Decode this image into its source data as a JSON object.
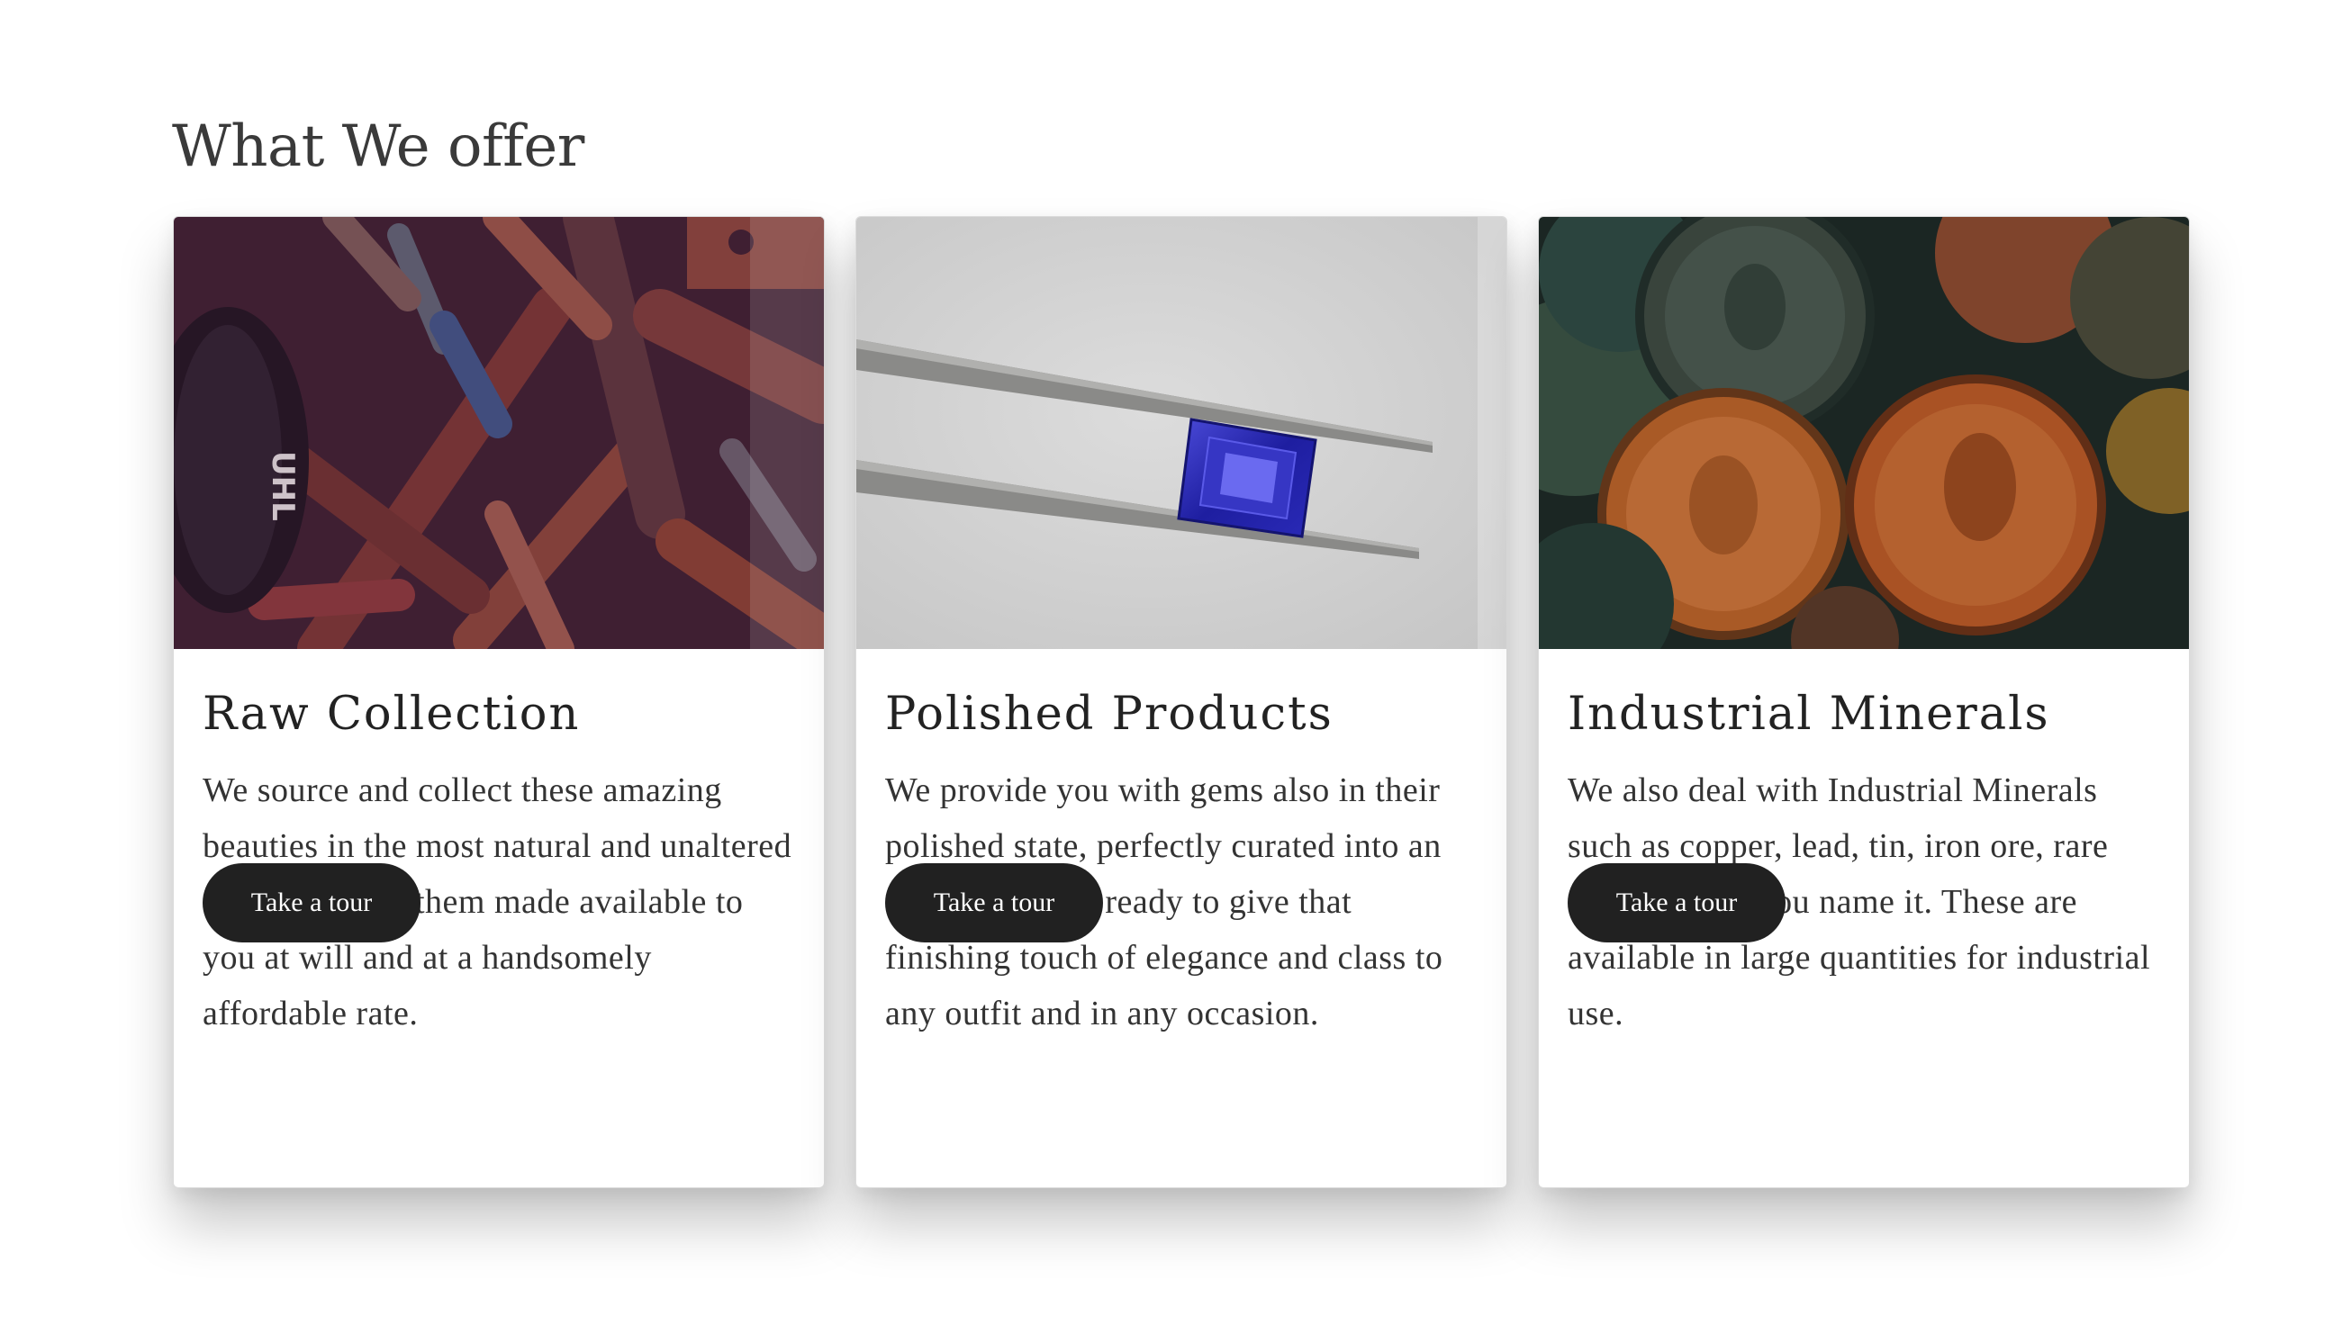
{
  "section": {
    "title": "What We offer"
  },
  "cards": [
    {
      "title": "Raw Collection",
      "text": "We source and collect these amazing beauties in the most natural and unaltered form and have them made available to you at will and at a handsomely affordable rate.",
      "button_label": "Take a tour",
      "image_label": "UHL"
    },
    {
      "title": "Polished Products",
      "text": "We provide you with gems also in their polished state, perfectly curated into an artistic wonder ready to give that finishing touch of elegance and class to any outfit and in any occasion.",
      "button_label": "Take a tour"
    },
    {
      "title": "Industrial Minerals",
      "text": "We also deal with Industrial Minerals such as copper, lead, tin, iron ore, rare earth metals, you name it. These are available in large quantities for industrial use.",
      "button_label": "Take a tour"
    }
  ],
  "colors": {
    "button_bg": "#212121",
    "button_text": "#ffffff",
    "title_text": "#3a3a3a"
  }
}
